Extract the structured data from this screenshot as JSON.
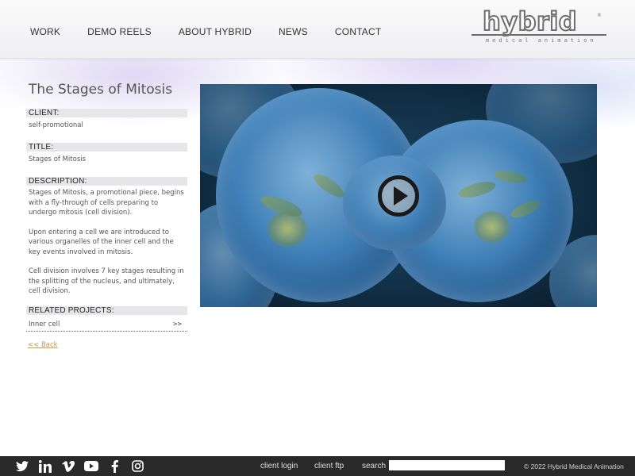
{
  "nav": {
    "items": [
      {
        "label": "WORK"
      },
      {
        "label": "DEMO REELS"
      },
      {
        "label": "ABOUT HYBRID"
      },
      {
        "label": "NEWS"
      },
      {
        "label": "CONTACT"
      }
    ]
  },
  "logo": {
    "word": "hybrid",
    "reg": "®",
    "tagline": "medical animation"
  },
  "project": {
    "title": "The Stages of Mitosis",
    "client_label": "CLIENT:",
    "client_value": "self-promotional",
    "title_label": "TITLE:",
    "title_value": "Stages of Mitosis",
    "description_label": "DESCRIPTION:",
    "description": [
      "Stages of Mitosis, a promotional piece, begins with a fly-through of cells preparing to undergo mitosis (cell division).",
      "Upon entering a cell we are introduced to various organelles of the inner cell and the key events involved in mitosis.",
      "Cell division involves 7 key stages resulting in the splitting of the nucleus, and ultimately, cell division."
    ],
    "related_label": "RELATED PROJECTS:",
    "related": [
      {
        "label": "Inner cell",
        "arrow": ">>"
      }
    ],
    "back_label": "<< Back"
  },
  "video": {
    "play_icon": "play-icon"
  },
  "footer": {
    "social_icons": [
      "twitter-icon",
      "linkedin-icon",
      "vimeo-icon",
      "youtube-icon",
      "facebook-icon",
      "instagram-icon"
    ],
    "client_login": "client login",
    "client_ftp": "client ftp",
    "search_label": "search",
    "search_value": "",
    "copyright": "© 2022 Hybrid Medical Animation"
  },
  "colors": {
    "footer_bg": "#2a2a2a",
    "link_accent": "#c8964c",
    "label_bar": "#e7e7ea"
  }
}
